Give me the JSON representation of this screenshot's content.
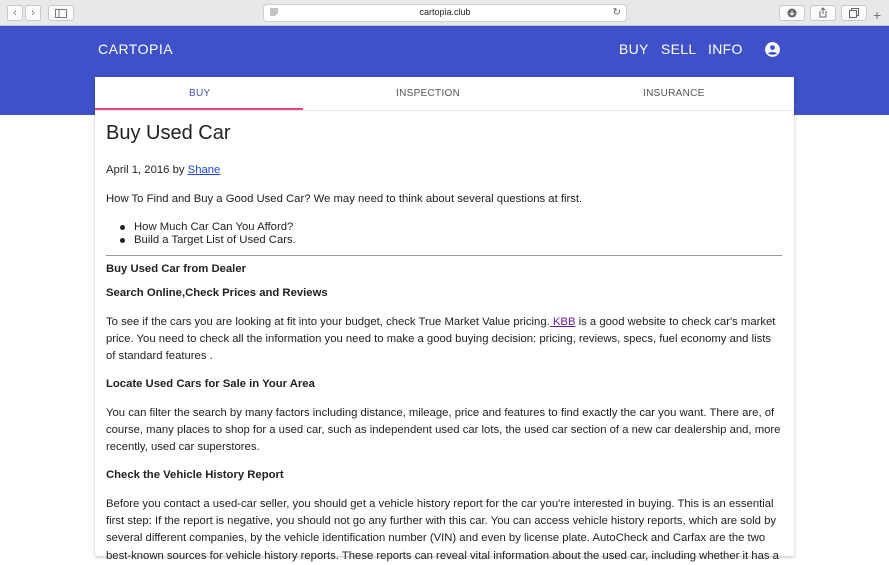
{
  "browser": {
    "url": "cartopia.club"
  },
  "nav": {
    "brand": "CARTOPIA",
    "links": [
      "BUY",
      "SELL",
      "INFO"
    ]
  },
  "tabs": [
    "BUY",
    "INSPECTION",
    "INSURANCE"
  ],
  "article": {
    "title": "Buy Used Car",
    "date": "April 1, 2016",
    "by": " by ",
    "author": "Shane",
    "intro": "How To Find and Buy a Good Used Car? We may need to think about several questions at first.",
    "bullets": [
      "How Much Car Can You Afford?",
      "Build a Target List of Used Cars."
    ],
    "section_title": "Buy Used Car from Dealer",
    "s1_title": "Search Online,Check Prices and Reviews",
    "s1_a": "To see if the cars you are looking at fit into your budget, check True Market Value pricing.",
    "s1_link": " KBB",
    "s1_b": " is a good website to check car's market price. You need to check all the information you need to make a good buying decision: pricing, reviews, specs, fuel economy and lists of standard features .",
    "s2_title": "Locate Used Cars for Sale in Your Area",
    "s2": "You can filter the search by many factors including distance, mileage, price and features to find exactly the car you want. There are, of course, many places to shop for a used car, such as independent used car lots, the used car section of a new car dealership and, more recently, used car superstores.",
    "s3_title": "Check the Vehicle History Report",
    "s3": "Before you contact a used-car seller, you should get a vehicle history report for the car you're interested in buying. This is an essential first step: If the report is negative, you should not go any further with this car. You can access vehicle history reports, which are sold by several different companies, by the vehicle identification number (VIN) and even by license plate. AutoCheck and Carfax are the two best-known sources for vehicle history reports. These reports can reveal vital information about the used car, including whether it has a"
  },
  "colors": {
    "header": "#3f51c9",
    "tab_indicator": "#e9437a",
    "link": "#1a47d6"
  }
}
